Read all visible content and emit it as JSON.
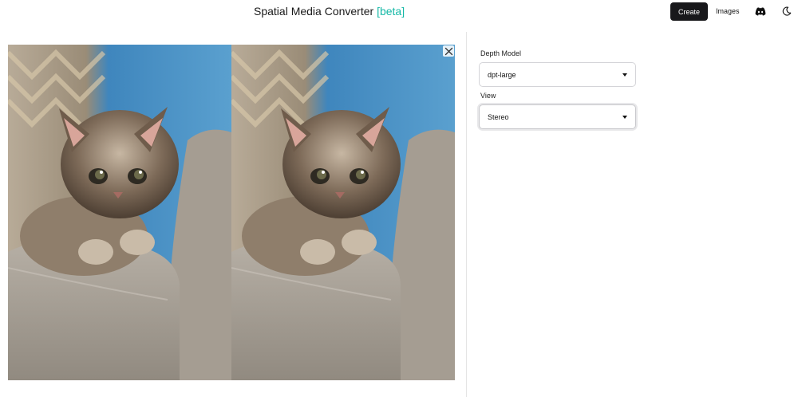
{
  "header": {
    "title": "Spatial Media Converter",
    "title_tag": "[beta]",
    "create_label": "Create",
    "images_label": "Images",
    "icons": [
      "discord-icon",
      "moon-icon"
    ]
  },
  "viewer": {
    "mode": "stereo",
    "subject": "kitten on sofa",
    "close_icon": "close-icon"
  },
  "settings": {
    "depth_model": {
      "label": "Depth Model",
      "value": "dpt-large"
    },
    "view": {
      "label": "View",
      "value": "Stereo"
    }
  },
  "colors": {
    "accent": "#14b8a6",
    "create_button_bg": "#18181b",
    "sofa": "#a9a196",
    "cushion": "#4f93c4"
  }
}
